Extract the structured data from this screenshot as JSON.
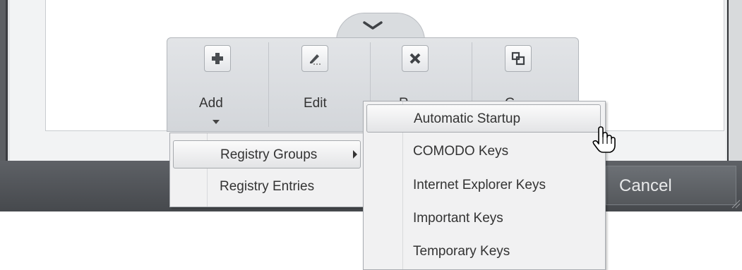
{
  "dialog": {
    "cancel_label": "Cancel"
  },
  "toolbar": {
    "toggle_icon": "chevron-down-icon",
    "items": [
      {
        "label": "Add",
        "icon": "plus-icon"
      },
      {
        "label": "Edit",
        "icon": "edit-icon"
      },
      {
        "label": "R",
        "icon": "remove-icon"
      },
      {
        "label": "G",
        "icon": "group-icon"
      }
    ]
  },
  "add_menu": {
    "items": [
      {
        "label": "Registry Groups"
      },
      {
        "label": "Registry Entries"
      }
    ]
  },
  "registry_groups_submenu": {
    "items": [
      {
        "label": "Automatic Startup"
      },
      {
        "label": "COMODO Keys"
      },
      {
        "label": "Internet Explorer Keys"
      },
      {
        "label": "Important Keys"
      },
      {
        "label": "Temporary Keys"
      }
    ]
  },
  "colors": {
    "bottom_bar": "#505357",
    "menu_bg": "#f1f1f2"
  }
}
